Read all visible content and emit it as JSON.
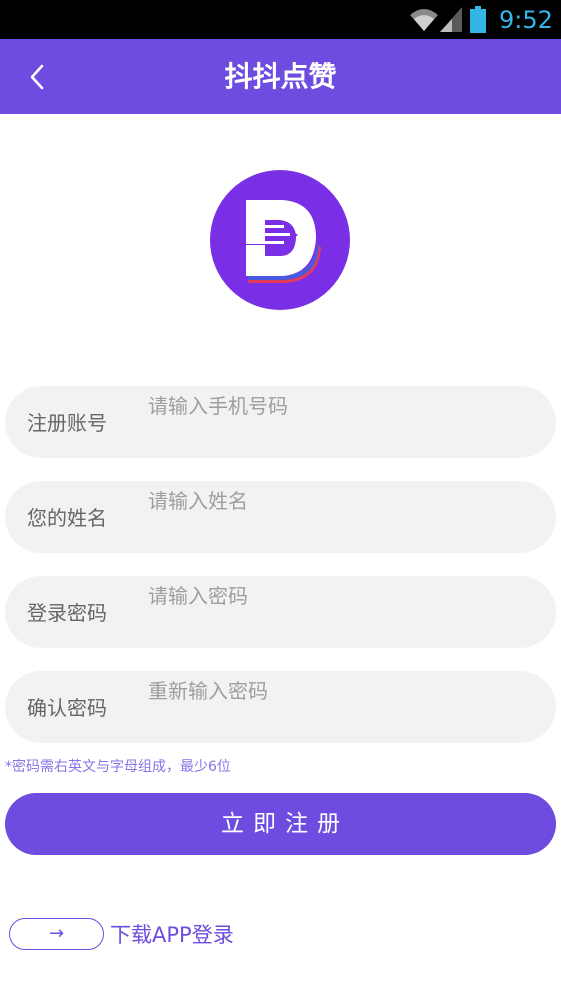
{
  "status_bar": {
    "time": "9:52",
    "icons": [
      "wifi-icon",
      "signal-icon",
      "battery-icon"
    ]
  },
  "header": {
    "title": "抖抖点赞",
    "back_icon": "chevron-left-icon"
  },
  "logo": {
    "icon": "brand-d-logo-icon"
  },
  "form": {
    "fields": [
      {
        "label": "注册账号",
        "placeholder": "请输入手机号码",
        "value": ""
      },
      {
        "label": "您的姓名",
        "placeholder": "请输入姓名",
        "value": ""
      },
      {
        "label": "登录密码",
        "placeholder": "请输入密码",
        "value": ""
      },
      {
        "label": "确认密码",
        "placeholder": "重新输入密码",
        "value": ""
      }
    ],
    "hint": "*密码需右英文与字母组成，最少6位",
    "submit_label": "立即注册"
  },
  "footer": {
    "arrow": "→",
    "download_label": "下载APP登录"
  },
  "colors": {
    "primary": "#6e4ce0",
    "status_time": "#33b5e5",
    "field_bg": "#f2f2f2"
  }
}
